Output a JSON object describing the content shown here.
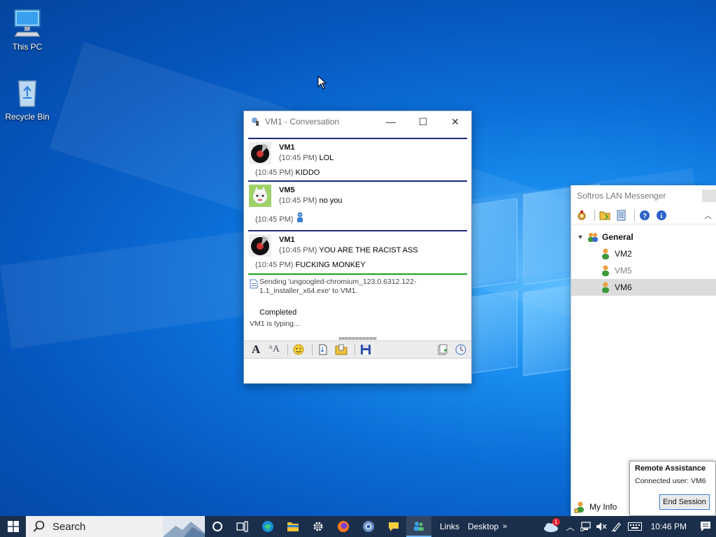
{
  "desktop": {
    "icons": [
      {
        "label": "This PC",
        "icon": "computer-icon"
      },
      {
        "label": "Recycle Bin",
        "icon": "recycle-bin-icon"
      }
    ]
  },
  "conversation": {
    "title": "VM1 - Conversation",
    "messages": [
      {
        "sender": "VM1",
        "lines": [
          {
            "time": "(10:45 PM)",
            "text": "LOL"
          },
          {
            "time": "(10:45 PM)",
            "text": "KIDDO"
          }
        ]
      },
      {
        "sender": "VM5",
        "lines": [
          {
            "time": "(10:45 PM)",
            "text": "no you"
          },
          {
            "time": "(10:45 PM)",
            "text": ""
          }
        ]
      },
      {
        "sender": "VM1",
        "lines": [
          {
            "time": "(10:45 PM)",
            "text": "YOU ARE THE RACIST ASS"
          },
          {
            "time": "(10:45 PM)",
            "text": "FUCKING MONKEY"
          }
        ]
      }
    ],
    "transfer": {
      "text": "Sending 'ungoogled-chromium_123.0.6312.122-1.1_installer_x64.exe' to VM1.",
      "status": "Completed"
    },
    "typing": "VM1 is typing..."
  },
  "messenger": {
    "title": "Softros LAN Messenger",
    "group": "General",
    "users": [
      {
        "name": "VM2",
        "dim": false,
        "selected": false
      },
      {
        "name": "VM5",
        "dim": true,
        "selected": false
      },
      {
        "name": "VM6",
        "dim": false,
        "selected": true
      }
    ],
    "my_info": "My Info"
  },
  "remote": {
    "title": "Remote Assistance",
    "connected": "Connected user: VM6",
    "end_button": "End Session"
  },
  "taskbar": {
    "search_label": "Search",
    "links": "Links",
    "desktop": "Desktop",
    "more": "»",
    "clock": "10:46 PM",
    "weather_badge": "1"
  }
}
